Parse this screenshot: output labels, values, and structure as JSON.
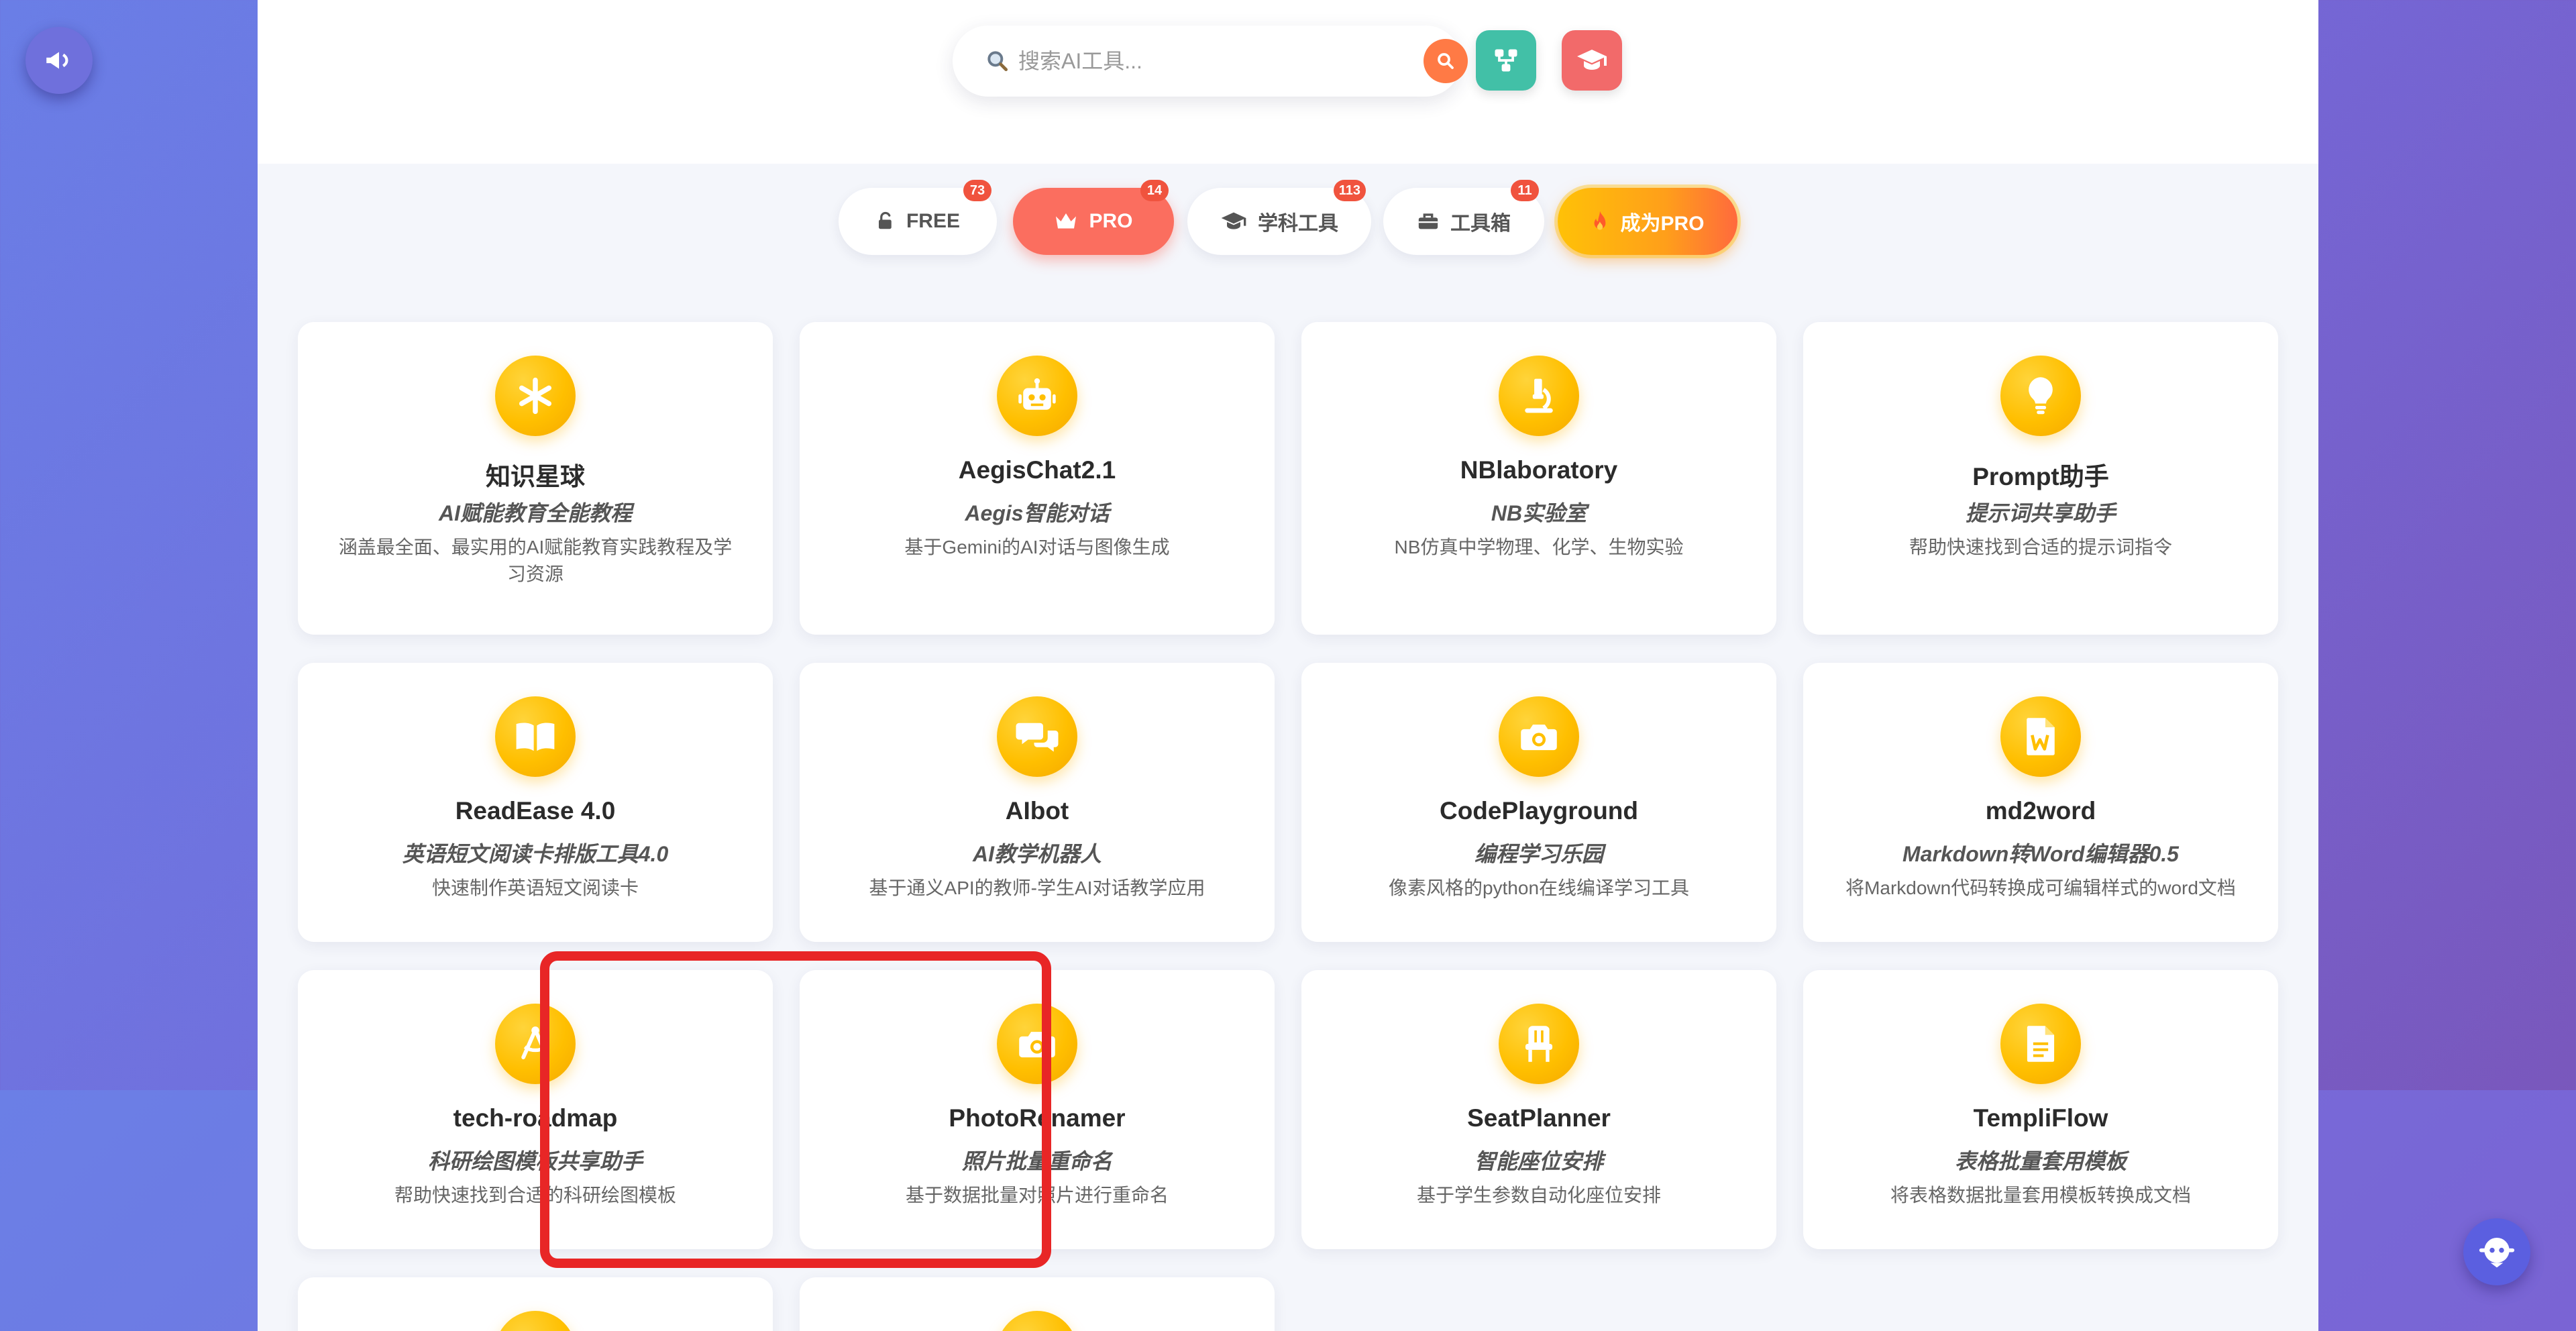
{
  "search": {
    "placeholder": "搜索AI工具..."
  },
  "header": {
    "share_icon": "share-nodes-icon",
    "edu_icon": "graduation-cap-icon"
  },
  "tabs": [
    {
      "label": "FREE",
      "badge": "73",
      "icon": "unlock-icon"
    },
    {
      "label": "PRO",
      "badge": "14",
      "icon": "crown-icon"
    },
    {
      "label": "学科工具",
      "badge": "113",
      "icon": "graduation-cap-icon"
    },
    {
      "label": "工具箱",
      "badge": "11",
      "icon": "toolbox-icon"
    },
    {
      "label": "成为PRO",
      "badge": "",
      "icon": "fire-icon"
    }
  ],
  "cards": [
    {
      "title": "知识星球",
      "subtitle": "AI赋能教育全能教程",
      "desc": "涵盖最全面、最实用的AI赋能教育实践教程及学习资源",
      "icon": "asterisk-icon"
    },
    {
      "title": "AegisChat2.1",
      "subtitle": "Aegis智能对话",
      "desc": "基于Gemini的AI对话与图像生成",
      "icon": "robot-icon"
    },
    {
      "title": "NBlaboratory",
      "subtitle": "NB实验室",
      "desc": "NB仿真中学物理、化学、生物实验",
      "icon": "microscope-icon"
    },
    {
      "title": "Prompt助手",
      "subtitle": "提示词共享助手",
      "desc": "帮助快速找到合适的提示词指令",
      "icon": "lightbulb-icon"
    },
    {
      "title": "ReadEase 4.0",
      "subtitle": "英语短文阅读卡排版工具4.0",
      "desc": "快速制作英语短文阅读卡",
      "icon": "book-open-icon"
    },
    {
      "title": "AIbot",
      "subtitle": "AI教学机器人",
      "desc": "基于通义API的教师-学生AI对话教学应用",
      "icon": "comments-icon"
    },
    {
      "title": "CodePlayground",
      "subtitle": "编程学习乐园",
      "desc": "像素风格的python在线编译学习工具",
      "icon": "camera-icon"
    },
    {
      "title": "md2word",
      "subtitle": "Markdown转Word编辑器0.5",
      "desc": "将Markdown代码转换成可编辑样式的word文档",
      "icon": "file-word-icon"
    },
    {
      "title": "tech-roadmap",
      "subtitle": "科研绘图模板共享助手",
      "desc": "帮助快速找到合适的科研绘图模板",
      "icon": "compass-drafting-icon"
    },
    {
      "title": "PhotoRenamer",
      "subtitle": "照片批量重命名",
      "desc": "基于数据批量对照片进行重命名",
      "icon": "camera-icon"
    },
    {
      "title": "SeatPlanner",
      "subtitle": "智能座位安排",
      "desc": "基于学生参数自动化座位安排",
      "icon": "chair-icon"
    },
    {
      "title": "TempliFlow",
      "subtitle": "表格批量套用模板",
      "desc": "将表格数据批量套用模板转换成文档",
      "icon": "file-lines-icon"
    }
  ],
  "floating": {
    "left_icon": "megaphone-icon",
    "right_icon": "chat-bot-icon"
  },
  "colors": {
    "accent_orange": "#ff7a45",
    "icon_gold": "#ffbf00",
    "active_tab": "#fb6e5f",
    "highlight_border": "#e82626"
  }
}
